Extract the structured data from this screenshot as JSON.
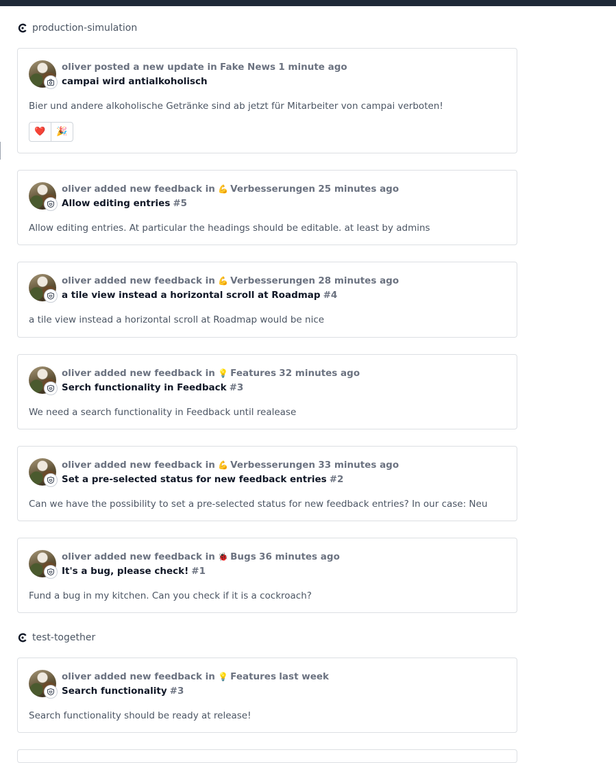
{
  "projects": [
    {
      "name": "production-simulation",
      "items": [
        {
          "user": "oliver",
          "action": "posted a new update in",
          "category_icon": "",
          "category": "Fake News",
          "time": "1 minute ago",
          "title": "campai wird antialkoholisch",
          "ticket": "",
          "body": "Bier und andere alkoholische Getränke sind ab jetzt für Mitarbeiter von campai verboten!",
          "badge_icon": "camera-icon",
          "reactions": [
            {
              "emoji": "❤️",
              "name": "heart-reaction"
            },
            {
              "emoji": "🎉",
              "name": "party-reaction"
            }
          ]
        },
        {
          "user": "oliver",
          "action": "added new feedback in",
          "category_icon": "💪",
          "category": "Verbesserungen",
          "time": "25 minutes ago",
          "title": "Allow editing entries",
          "ticket": "#5",
          "body": "Allow editing entries. At particular the headings should be editable. at least by admins",
          "badge_icon": "feedback-icon"
        },
        {
          "user": "oliver",
          "action": "added new feedback in",
          "category_icon": "💪",
          "category": "Verbesserungen",
          "time": "28 minutes ago",
          "title": "a tile view instead a horizontal scroll at Roadmap",
          "ticket": "#4",
          "body": "a tile view instead a horizontal scroll at Roadmap would be nice",
          "badge_icon": "feedback-icon"
        },
        {
          "user": "oliver",
          "action": "added new feedback in",
          "category_icon": "💡",
          "category": "Features",
          "time": "32 minutes ago",
          "title": "Serch functionality in Feedback",
          "ticket": "#3",
          "body": "We need a search functionality in Feedback until realease",
          "badge_icon": "feedback-icon"
        },
        {
          "user": "oliver",
          "action": "added new feedback in",
          "category_icon": "💪",
          "category": "Verbesserungen",
          "time": "33 minutes ago",
          "title": "Set a pre-selected status for new feedback entries",
          "ticket": "#2",
          "body": "Can we have the possibility to set a pre-selected status for new feedback entries? In our case: Neu",
          "badge_icon": "feedback-icon"
        },
        {
          "user": "oliver",
          "action": "added new feedback in",
          "category_icon": "🐞",
          "category": "Bugs",
          "time": "36 minutes ago",
          "title": "It's a bug, please check!",
          "ticket": "#1",
          "body": "Fund a bug in my kitchen. Can you check if it is a cockroach?",
          "badge_icon": "feedback-icon"
        }
      ]
    },
    {
      "name": "test-together",
      "items": [
        {
          "user": "oliver",
          "action": "added new feedback in",
          "category_icon": "💡",
          "category": "Features",
          "time": "last week",
          "title": "Search functionality",
          "ticket": "#3",
          "body": "Search functionality should be ready at release!",
          "badge_icon": "feedback-icon"
        }
      ]
    }
  ]
}
